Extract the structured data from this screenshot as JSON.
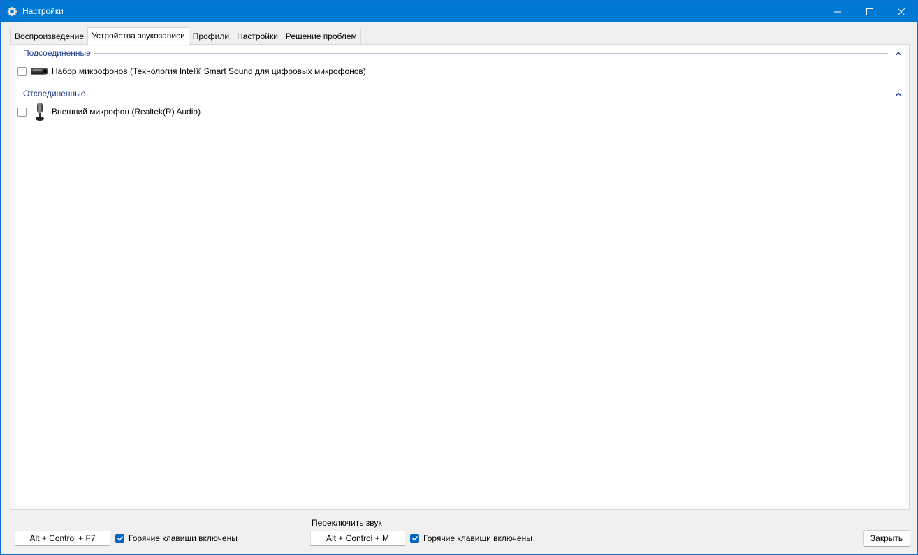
{
  "window": {
    "title": "Настройки",
    "icon": "gear-icon",
    "accent_color": "#0078d4"
  },
  "tabs": [
    {
      "label": "Воспроизведение",
      "active": false
    },
    {
      "label": "Устройства звукозаписи",
      "active": true
    },
    {
      "label": "Профили",
      "active": false
    },
    {
      "label": "Настройки",
      "active": false
    },
    {
      "label": "Решение проблем",
      "active": false
    }
  ],
  "groups": [
    {
      "label": "Подсоединенные",
      "devices": [
        {
          "label": "Набор микрофонов (Технология Intel® Smart Sound для цифровых микрофонов)",
          "icon": "microphone-array-icon",
          "checked": false
        }
      ]
    },
    {
      "label": "Отсоединенные",
      "devices": [
        {
          "label": "Внешний микрофон (Realtek(R) Audio)",
          "icon": "microphone-icon",
          "checked": false
        }
      ]
    }
  ],
  "hotkeys": {
    "title": "Переключить звук",
    "left": {
      "keys": "Alt + Control + F7",
      "enabled_label": "Горячие клавиши включены",
      "enabled": true
    },
    "right": {
      "keys": "Alt + Control + M",
      "enabled_label": "Горячие клавиши включены",
      "enabled": true
    }
  },
  "footer": {
    "close_label": "Закрыть"
  }
}
